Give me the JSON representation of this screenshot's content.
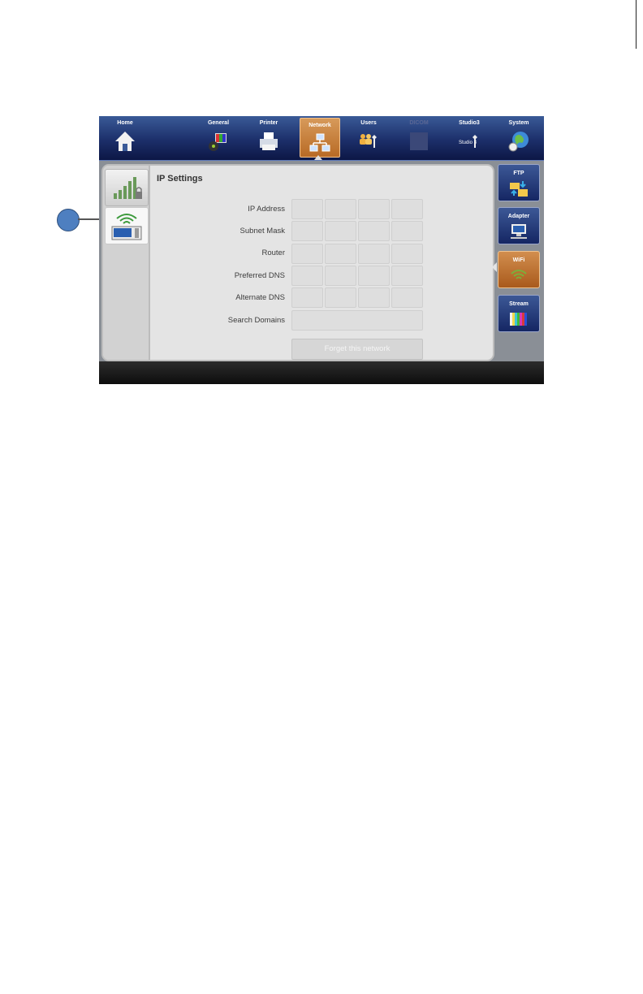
{
  "nav": {
    "items": [
      {
        "label": "Home",
        "icon": "home-icon"
      },
      {
        "label": "General",
        "icon": "general-icon"
      },
      {
        "label": "Printer",
        "icon": "printer-icon"
      },
      {
        "label": "Network",
        "icon": "network-icon",
        "active": true
      },
      {
        "label": "Users",
        "icon": "users-icon"
      },
      {
        "label": "DICOM",
        "icon": "dicom-icon",
        "disabled": true
      },
      {
        "label": "Studio3",
        "icon": "studio3-icon"
      },
      {
        "label": "System",
        "icon": "system-icon"
      }
    ],
    "studio_icon_text": "Studio 3"
  },
  "panel": {
    "title": "IP Settings",
    "rows": [
      {
        "label": "IP Address"
      },
      {
        "label": "Subnet Mask"
      },
      {
        "label": "Router"
      },
      {
        "label": "Preferred DNS"
      },
      {
        "label": "Alternate DNS"
      },
      {
        "label": "Search Domains"
      }
    ],
    "forget_button": "Forget this network"
  },
  "side_tabs": [
    {
      "icon": "signal-lock-icon"
    },
    {
      "icon": "wifi-device-icon",
      "selected": true
    }
  ],
  "right_nav": [
    {
      "label": "FTP",
      "icon": "ftp-folder-icon"
    },
    {
      "label": "Adapter",
      "icon": "adapter-monitor-icon"
    },
    {
      "label": "WiFi",
      "icon": "wifi-icon",
      "active": true
    },
    {
      "label": "Stream",
      "icon": "stream-bars-icon"
    }
  ],
  "colors": {
    "nav_active": "#c47a38",
    "nav_bg": "#1c2f6a",
    "callout": "#4e7fc0"
  }
}
